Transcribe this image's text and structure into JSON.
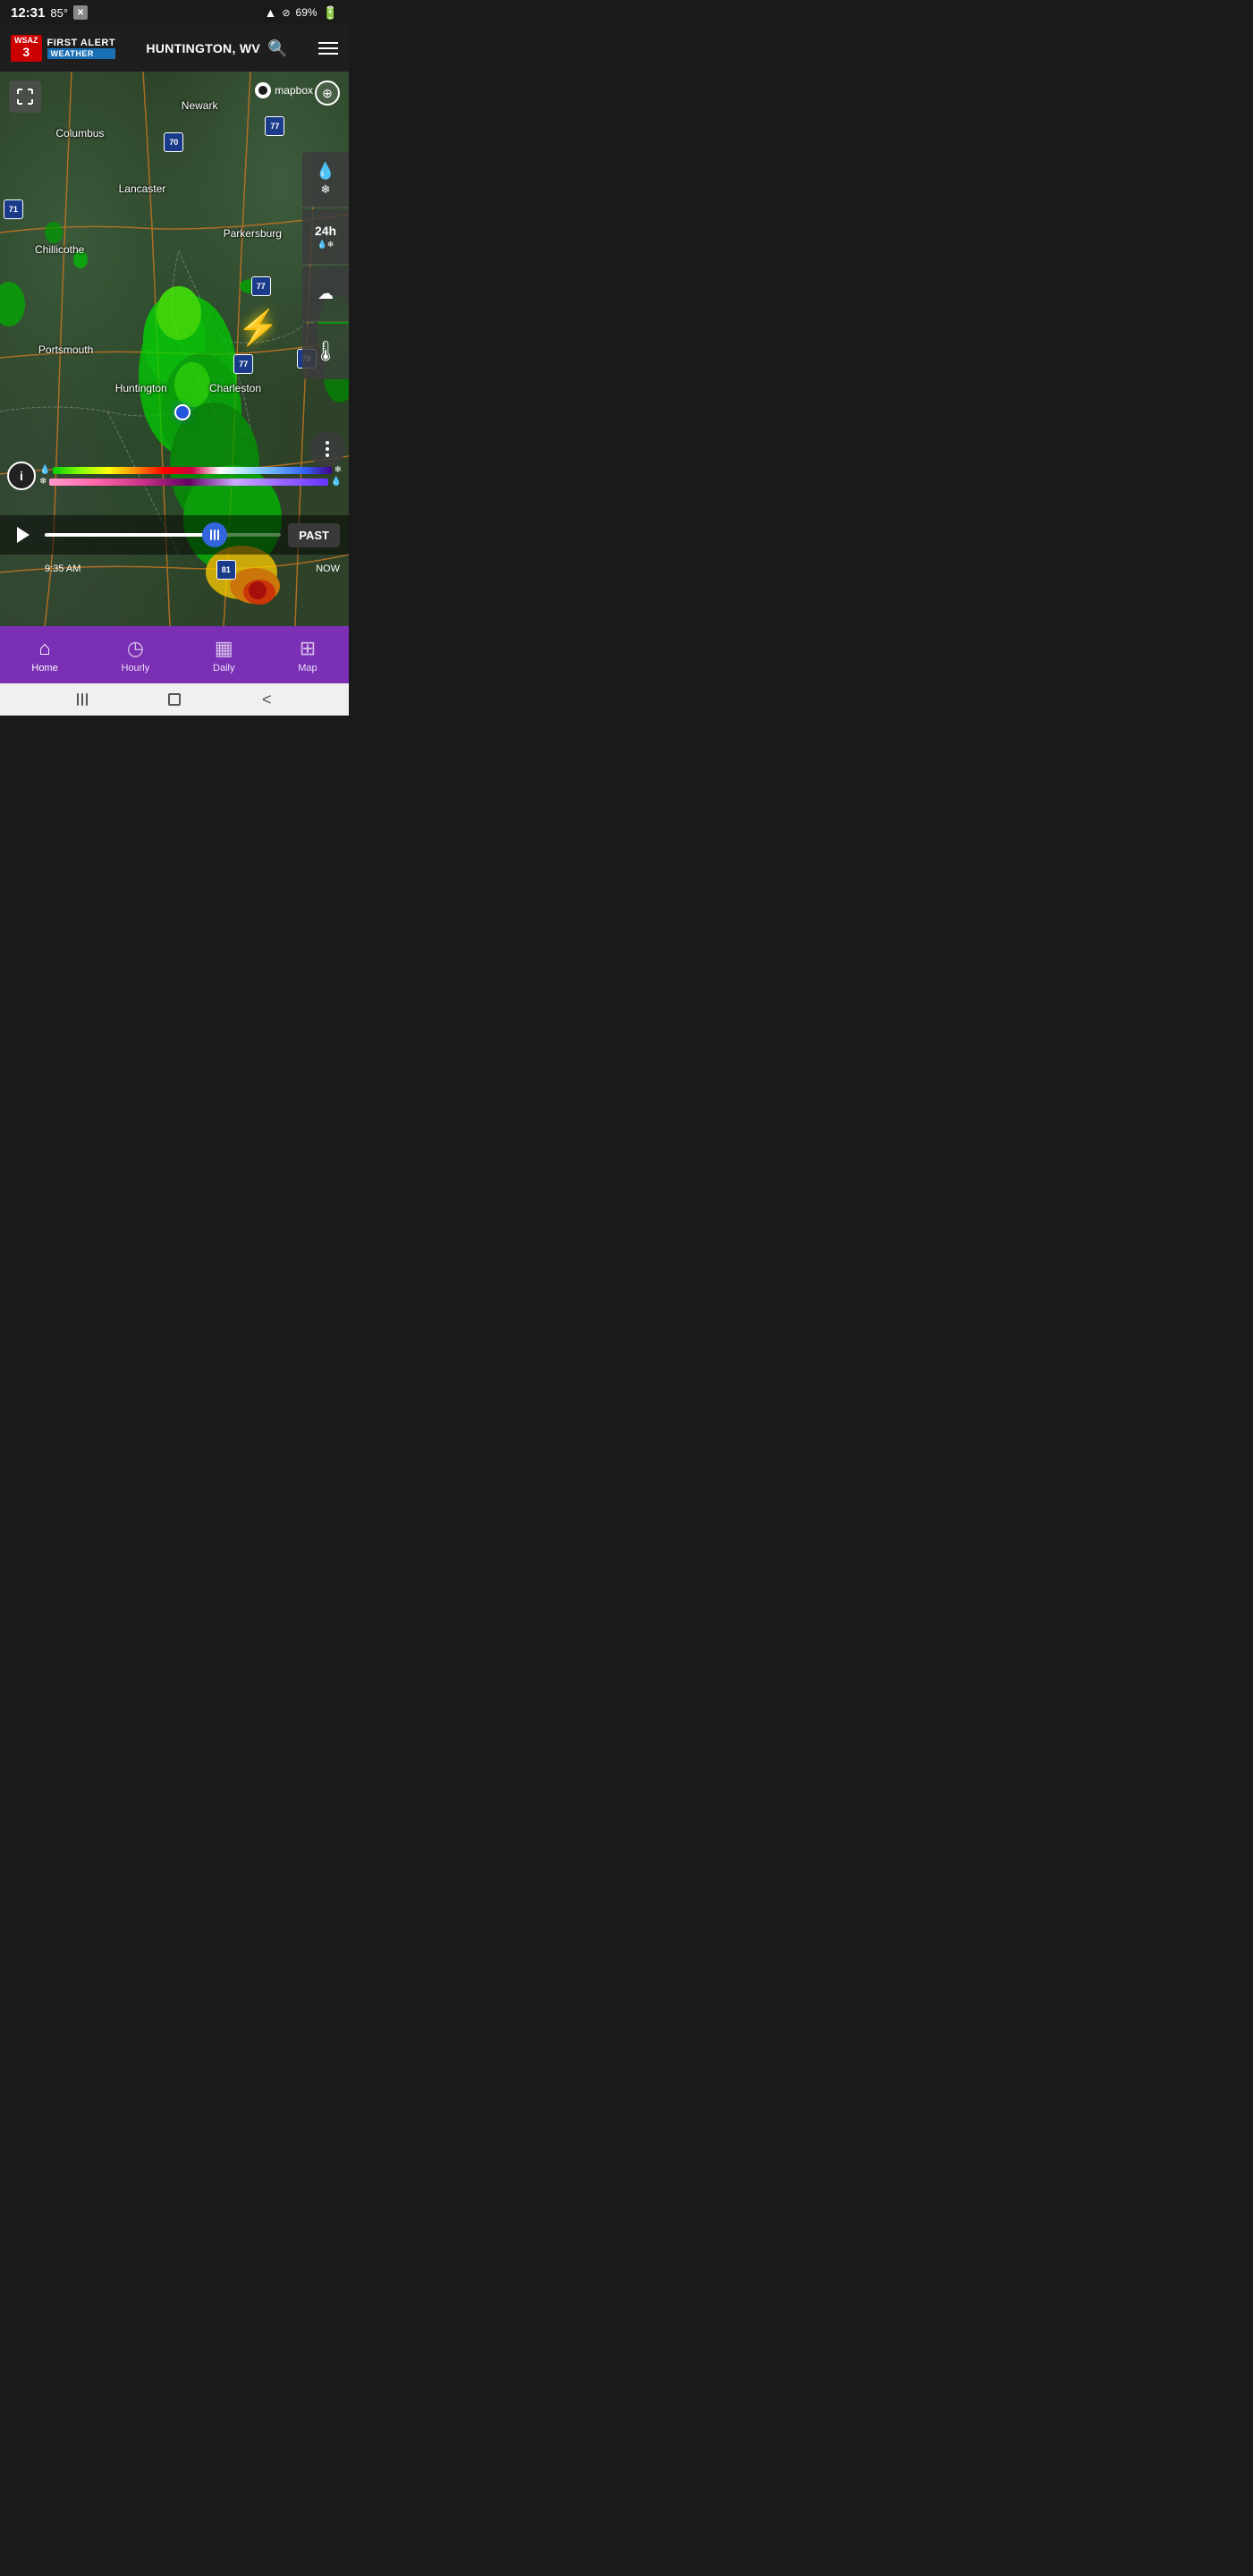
{
  "statusBar": {
    "time": "12:31",
    "temperature": "85°",
    "wifi": "📶",
    "battery": "69%"
  },
  "header": {
    "channelNumber": "3",
    "firstAlert": "FIRST ALERT",
    "weather": "WEATHER",
    "location": "HUNTINGTON, WV",
    "menuIcon": "menu"
  },
  "map": {
    "mapboxLabel": "mapbox",
    "cities": [
      {
        "name": "Newark",
        "top": "5",
        "left": "52"
      },
      {
        "name": "Columbus",
        "top": "12",
        "left": "20"
      },
      {
        "name": "Lancaster",
        "top": "22",
        "left": "36"
      },
      {
        "name": "Chillicothe",
        "top": "33",
        "left": "14"
      },
      {
        "name": "Parkersburg",
        "top": "30",
        "left": "72"
      },
      {
        "name": "Portsmouth",
        "top": "50",
        "left": "14"
      },
      {
        "name": "Huntington",
        "top": "57",
        "left": "38"
      },
      {
        "name": "Charleston",
        "top": "57",
        "left": "65"
      }
    ],
    "interstates": [
      {
        "label": "70",
        "type": "blue",
        "top": "13",
        "left": "50"
      },
      {
        "label": "77",
        "type": "blue",
        "top": "10",
        "left": "74"
      },
      {
        "label": "71",
        "type": "blue",
        "top": "25",
        "left": "0"
      },
      {
        "label": "77",
        "type": "blue",
        "top": "38",
        "left": "70"
      },
      {
        "label": "77",
        "type": "blue",
        "top": "52",
        "left": "66"
      },
      {
        "label": "79",
        "type": "blue",
        "top": "52",
        "left": "84"
      },
      {
        "label": "81",
        "type": "blue",
        "top": "90",
        "left": "65"
      }
    ]
  },
  "legend": {
    "infoLabel": "i",
    "precipIcon1": "💧",
    "precipIcon2": "❄",
    "winterIcon1": "❄",
    "winterIcon2": "💧"
  },
  "playback": {
    "playLabel": "▶",
    "timeStart": "9:35 AM",
    "timeNow": "NOW",
    "pastLabel": "PAST",
    "progress": 72
  },
  "bottomNav": {
    "items": [
      {
        "label": "Home",
        "icon": "🏠",
        "active": true
      },
      {
        "label": "Hourly",
        "icon": "⏰",
        "active": false
      },
      {
        "label": "Daily",
        "icon": "📅",
        "active": false
      },
      {
        "label": "Map",
        "icon": "🗺",
        "active": false
      }
    ]
  },
  "rightPanel": {
    "buttons": [
      {
        "icon": "💧❄",
        "label": ""
      },
      {
        "icon": "24h",
        "label": "24h",
        "subIcon": "💧❄"
      },
      {
        "icon": "☁",
        "label": ""
      },
      {
        "icon": "🌡",
        "label": ""
      }
    ]
  }
}
